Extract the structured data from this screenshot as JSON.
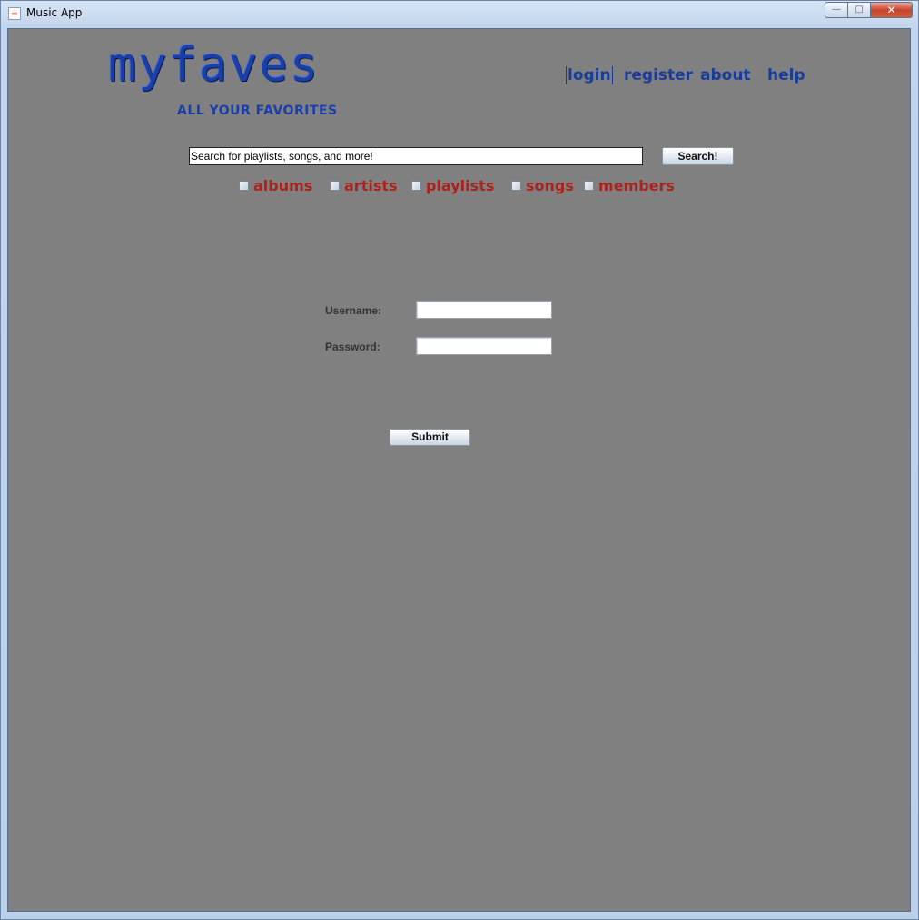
{
  "window": {
    "title": "Music App",
    "controls": {
      "minimize": "—",
      "maximize": "□",
      "close": "✕"
    }
  },
  "logo": {
    "main": "myfaves",
    "tagline": "ALL YOUR FAVORITES"
  },
  "nav": {
    "login": "login",
    "register": "register",
    "about": "about",
    "help": "help"
  },
  "search": {
    "value": "Search for playlists, songs, and more!",
    "button_label": "Search!"
  },
  "filters": [
    {
      "label": "albums",
      "checked": false
    },
    {
      "label": "artists",
      "checked": false
    },
    {
      "label": "playlists",
      "checked": false
    },
    {
      "label": "songs",
      "checked": false
    },
    {
      "label": "members",
      "checked": false
    }
  ],
  "login_form": {
    "username_label": "Username:",
    "password_label": "Password:",
    "username_value": "",
    "password_value": "",
    "submit_label": "Submit"
  },
  "colors": {
    "background": "#808080",
    "nav_link": "#1a3d9a",
    "filter_label": "#a8241c",
    "logo": "#1b3fa8"
  },
  "icons": {
    "app": "java-cup-icon"
  }
}
